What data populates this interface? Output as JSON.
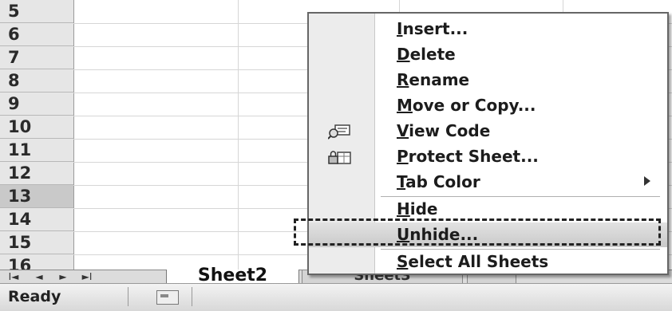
{
  "grid": {
    "row_numbers": [
      "5",
      "6",
      "7",
      "8",
      "9",
      "10",
      "11",
      "12",
      "13",
      "14",
      "15",
      "16"
    ],
    "selected_row": "13"
  },
  "tabs": {
    "nav": [
      "I◄",
      "◄",
      "►",
      "►I"
    ],
    "active": "Sheet2",
    "other": "Sheet3"
  },
  "status": {
    "text": "Ready",
    "macro_icon": "record-macro-icon"
  },
  "context_menu": {
    "items": [
      {
        "label": "Insert...",
        "accel": "I",
        "rest": "nsert..."
      },
      {
        "label": "Delete",
        "accel": "D",
        "rest": "elete"
      },
      {
        "label": "Rename",
        "accel": "R",
        "rest": "ename"
      },
      {
        "label": "Move or Copy...",
        "accel": "M",
        "rest": "ove or Copy..."
      },
      {
        "label": "View Code",
        "accel": "V",
        "rest": "iew Code",
        "icon": "view-code-icon"
      },
      {
        "label": "Protect Sheet...",
        "accel": "P",
        "rest": "rotect Sheet...",
        "icon": "protect-sheet-icon"
      },
      {
        "label": "Tab Color",
        "accel": "T",
        "rest": "ab Color",
        "submenu": true
      },
      {
        "label": "Hide",
        "accel": "H",
        "rest": "ide"
      },
      {
        "label": "Unhide...",
        "accel": "U",
        "rest": "nhide...",
        "highlighted": true
      },
      {
        "label": "Select All Sheets",
        "accel": "S",
        "rest": "elect All Sheets"
      }
    ]
  }
}
